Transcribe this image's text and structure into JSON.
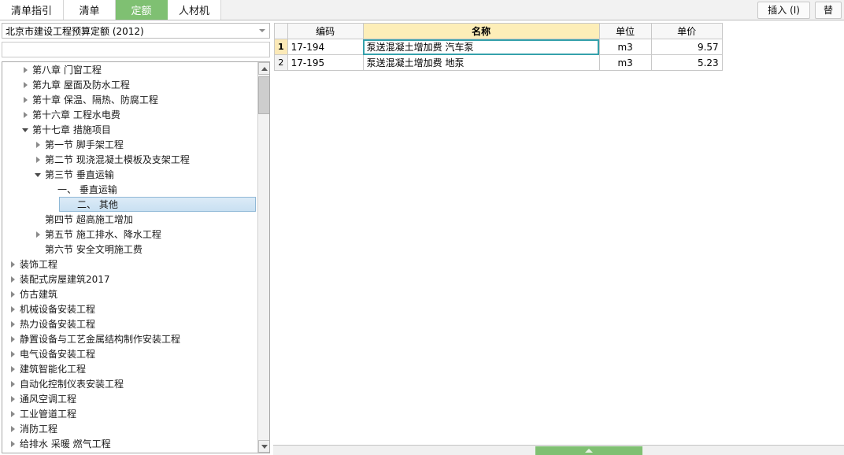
{
  "tabs": [
    {
      "label": "清单指引",
      "active": false
    },
    {
      "label": "清单",
      "active": false
    },
    {
      "label": "定额",
      "active": true
    },
    {
      "label": "人材机",
      "active": false
    }
  ],
  "toolbar": {
    "insert_label": "插入 (I)",
    "replace_label": "替"
  },
  "sidebar": {
    "combo_value": "北京市建设工程预算定额 (2012)",
    "combo_arrow_icon": "chevron-down-icon",
    "filter_value": "",
    "filter_placeholder": "",
    "scroll_up_icon": "scroll-up-arrow-icon",
    "scroll_down_icon": "scroll-down-arrow-icon",
    "tree": [
      {
        "label": "第八章 门窗工程",
        "depth": 1,
        "state": "collapsed"
      },
      {
        "label": "第九章 屋面及防水工程",
        "depth": 1,
        "state": "collapsed"
      },
      {
        "label": "第十章 保温、隔热、防腐工程",
        "depth": 1,
        "state": "collapsed"
      },
      {
        "label": "第十六章 工程水电费",
        "depth": 1,
        "state": "collapsed"
      },
      {
        "label": "第十七章 措施项目",
        "depth": 1,
        "state": "expanded"
      },
      {
        "label": "第一节 脚手架工程",
        "depth": 2,
        "state": "collapsed"
      },
      {
        "label": "第二节 现浇混凝土模板及支架工程",
        "depth": 2,
        "state": "collapsed"
      },
      {
        "label": "第三节 垂直运输",
        "depth": 2,
        "state": "expanded"
      },
      {
        "label": "一、 垂直运输",
        "depth": 3,
        "state": "leaf"
      },
      {
        "label": "二、 其他",
        "depth": 3,
        "state": "leaf",
        "selected": true
      },
      {
        "label": "第四节 超高施工增加",
        "depth": 2,
        "state": "leaf"
      },
      {
        "label": "第五节 施工排水、降水工程",
        "depth": 2,
        "state": "collapsed"
      },
      {
        "label": "第六节 安全文明施工费",
        "depth": 2,
        "state": "leaf"
      },
      {
        "label": "装饰工程",
        "depth": 0,
        "state": "collapsed"
      },
      {
        "label": "装配式房屋建筑2017",
        "depth": 0,
        "state": "collapsed"
      },
      {
        "label": "仿古建筑",
        "depth": 0,
        "state": "collapsed"
      },
      {
        "label": "机械设备安装工程",
        "depth": 0,
        "state": "collapsed"
      },
      {
        "label": "热力设备安装工程",
        "depth": 0,
        "state": "collapsed"
      },
      {
        "label": "静置设备与工艺金属结构制作安装工程",
        "depth": 0,
        "state": "collapsed"
      },
      {
        "label": "电气设备安装工程",
        "depth": 0,
        "state": "collapsed"
      },
      {
        "label": "建筑智能化工程",
        "depth": 0,
        "state": "collapsed"
      },
      {
        "label": "自动化控制仪表安装工程",
        "depth": 0,
        "state": "collapsed"
      },
      {
        "label": "通风空调工程",
        "depth": 0,
        "state": "collapsed"
      },
      {
        "label": "工业管道工程",
        "depth": 0,
        "state": "collapsed"
      },
      {
        "label": "消防工程",
        "depth": 0,
        "state": "collapsed"
      },
      {
        "label": "给排水 采暖 燃气工程",
        "depth": 0,
        "state": "collapsed"
      }
    ]
  },
  "grid": {
    "columns": [
      {
        "key": "code",
        "label": "编码"
      },
      {
        "key": "name",
        "label": "名称"
      },
      {
        "key": "unit",
        "label": "单位"
      },
      {
        "key": "price",
        "label": "单价"
      }
    ],
    "rows": [
      {
        "num": "1",
        "code": "17-194",
        "name": "泵送混凝土增加费 汽车泵",
        "unit": "m3",
        "price": "9.57",
        "selected": true
      },
      {
        "num": "2",
        "code": "17-195",
        "name": "泵送混凝土增加费 地泵",
        "unit": "m3",
        "price": "5.23",
        "selected": false
      }
    ]
  },
  "bottom": {
    "grabber_icon": "collapse-up-arrow-icon"
  },
  "colors": {
    "accent_green": "#7fc072",
    "name_header": "#fdeeb8",
    "selection_blue": "#c9e0f2",
    "cell_focus": "#35a1ab"
  }
}
